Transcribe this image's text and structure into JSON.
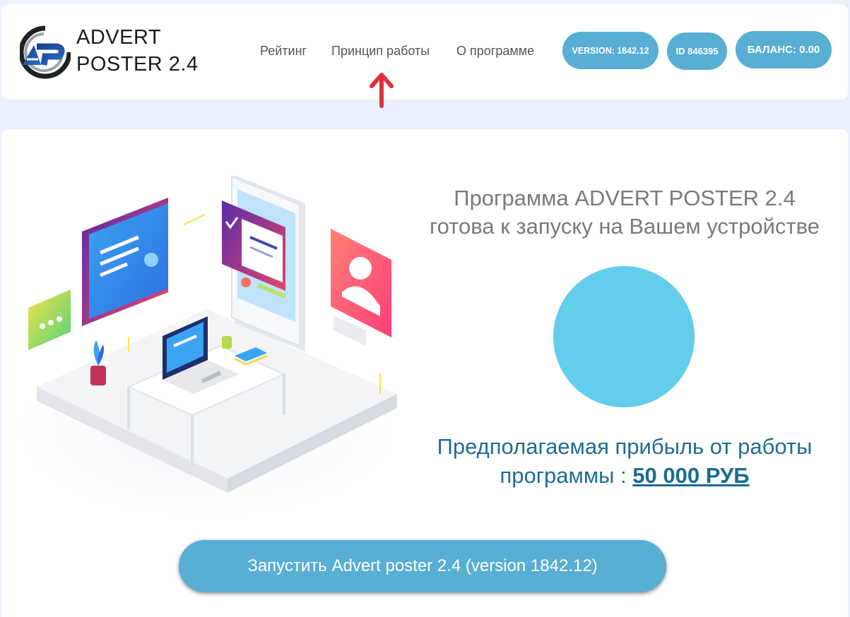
{
  "header": {
    "logo_line1": "ADVERT",
    "logo_line2": "POSTER 2.4",
    "nav": [
      "Рейтинг",
      "Принцип работы",
      "О программе"
    ],
    "version_badge": "VERSION: 1842.12",
    "id_badge": "ID 846395",
    "balance_badge": "БАЛАНС: 0.00"
  },
  "main": {
    "headline": "Программа ADVERT POSTER 2.4 готова к запуску на Вашем устройстве",
    "profit_label": "Предполагаемая прибыль от работы программы :",
    "profit_amount": "50 000 РУБ",
    "launch_button": "Запустить Advert poster 2.4 (version 1842.12)"
  },
  "colors": {
    "accent": "#58aed3",
    "circle": "#63cdec",
    "profit_text": "#1e6d94",
    "arrow": "#d9323a",
    "page_bg": "#eaf0fd"
  }
}
